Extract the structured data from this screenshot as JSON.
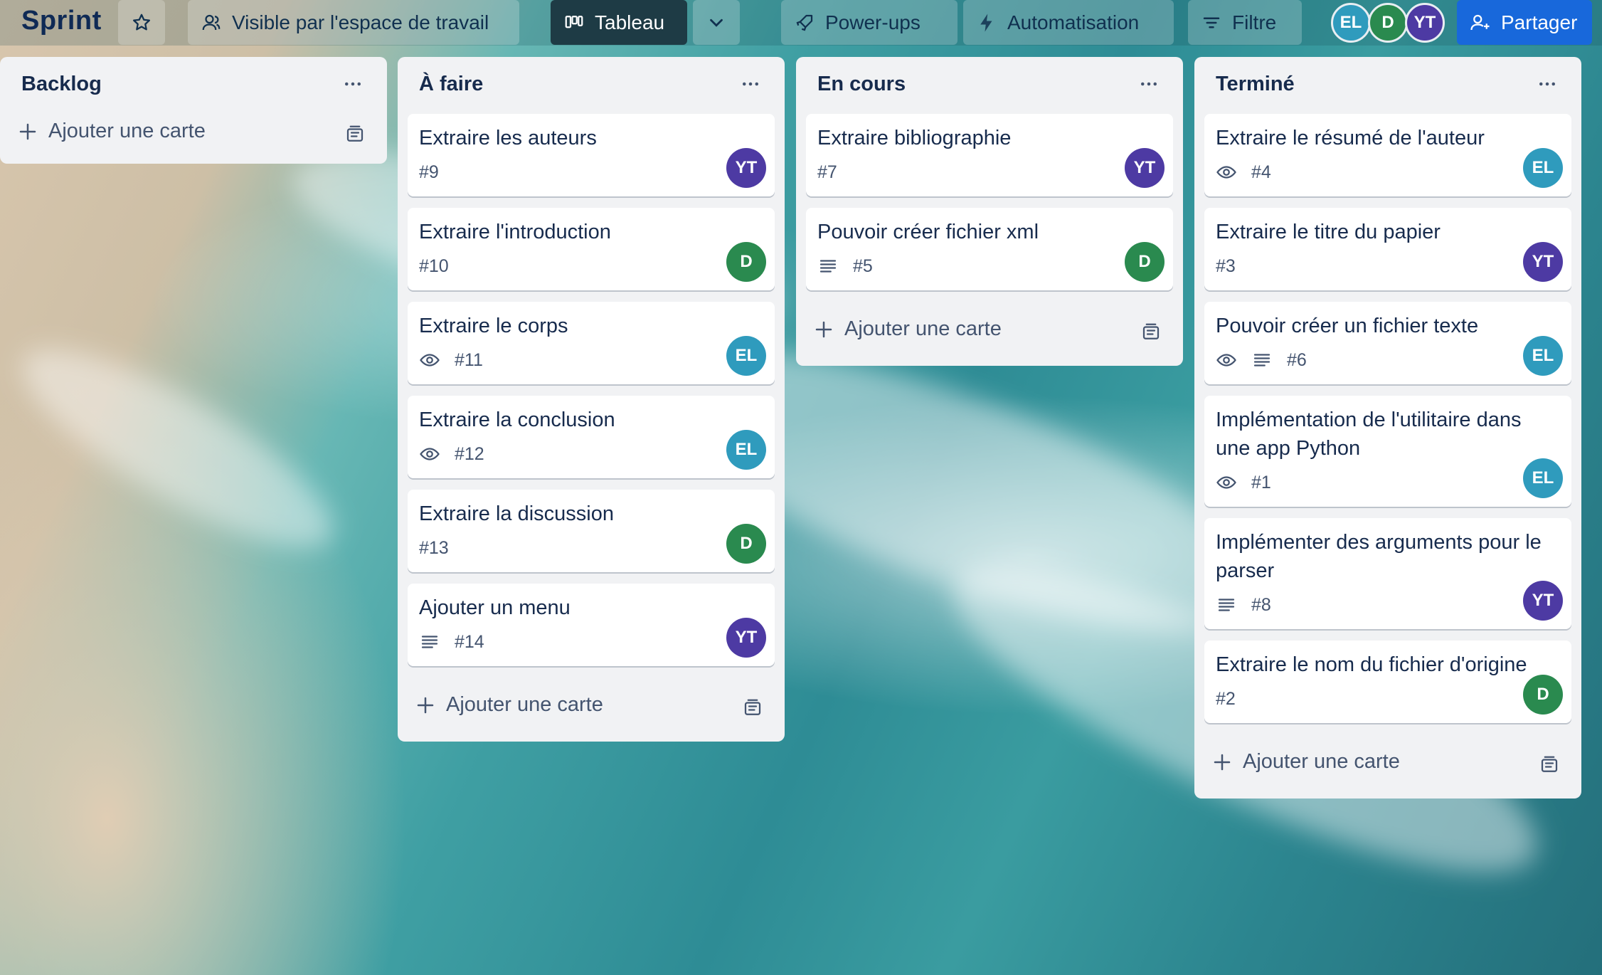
{
  "header": {
    "board_title": "Sprint",
    "visibility_label": "Visible par l'espace de travail",
    "view_label": "Tableau",
    "powerups_label": "Power-ups",
    "automation_label": "Automatisation",
    "filter_label": "Filtre",
    "share_label": "Partager",
    "members": [
      "EL",
      "D",
      "YT"
    ]
  },
  "colors": {
    "EL": "#2f9bbd",
    "D": "#2a8a4f",
    "YT": "#4d3aa3",
    "share": "#1868db",
    "list_bg": "#f1f2f4"
  },
  "lists": [
    {
      "title": "Backlog",
      "add_label": "Ajouter une carte",
      "cards": []
    },
    {
      "title": "À faire",
      "add_label": "Ajouter une carte",
      "cards": [
        {
          "title": "Extraire les auteurs",
          "number": "#9",
          "watch": false,
          "desc": false,
          "member": "YT"
        },
        {
          "title": "Extraire l'introduction",
          "number": "#10",
          "watch": false,
          "desc": false,
          "member": "D"
        },
        {
          "title": "Extraire le corps",
          "number": "#11",
          "watch": true,
          "desc": false,
          "member": "EL"
        },
        {
          "title": "Extraire la conclusion",
          "number": "#12",
          "watch": true,
          "desc": false,
          "member": "EL"
        },
        {
          "title": "Extraire la discussion",
          "number": "#13",
          "watch": false,
          "desc": false,
          "member": "D"
        },
        {
          "title": "Ajouter un menu",
          "number": "#14",
          "watch": false,
          "desc": true,
          "member": "YT"
        }
      ]
    },
    {
      "title": "En cours",
      "add_label": "Ajouter une carte",
      "cards": [
        {
          "title": "Extraire bibliographie",
          "number": "#7",
          "watch": false,
          "desc": false,
          "member": "YT"
        },
        {
          "title": "Pouvoir créer fichier xml",
          "number": "#5",
          "watch": false,
          "desc": true,
          "member": "D"
        }
      ]
    },
    {
      "title": "Terminé",
      "add_label": "Ajouter une carte",
      "cards": [
        {
          "title": "Extraire le résumé de l'auteur",
          "number": "#4",
          "watch": true,
          "desc": false,
          "member": "EL"
        },
        {
          "title": "Extraire le titre du papier",
          "number": "#3",
          "watch": false,
          "desc": false,
          "member": "YT"
        },
        {
          "title": "Pouvoir créer un fichier texte",
          "number": "#6",
          "watch": true,
          "desc": true,
          "member": "EL"
        },
        {
          "title": "Implémentation de l'utilitaire dans une app Python",
          "number": "#1",
          "watch": true,
          "desc": false,
          "member": "EL"
        },
        {
          "title": "Implémenter des arguments pour le parser",
          "number": "#8",
          "watch": false,
          "desc": true,
          "member": "YT"
        },
        {
          "title": "Extraire le nom du fichier d'origine",
          "number": "#2",
          "watch": false,
          "desc": false,
          "member": "D"
        }
      ]
    }
  ]
}
